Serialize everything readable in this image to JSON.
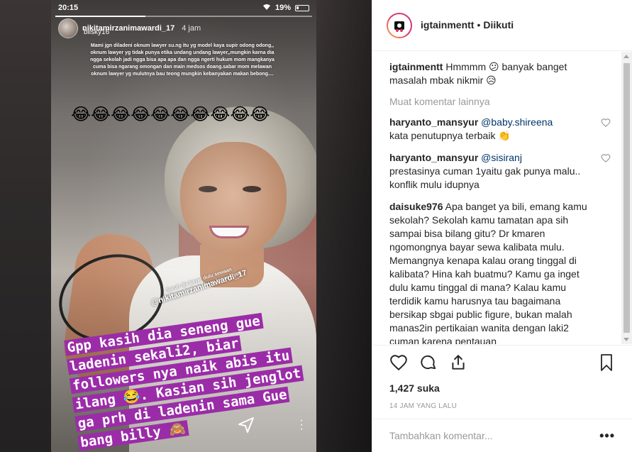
{
  "story": {
    "status_time": "20:15",
    "battery": "19%",
    "username": "nikitamirzanimawardi_17",
    "time": "4 jam",
    "tag": "bilsky16",
    "progress_fraction": 0.35,
    "top_text": "Mami jgn diladeni oknum lawyer su.ng itu yg model kaya supir odong odong,, oknum lawyer yg tidak punya etika undang undang lawyer,,mungkin karna dia ngga sekolah jadi ngga bisa apa apa dan ngga ngerti hukum mom mangkanya cuma bisa ngarang omongan dan main medsos doang.sabar mom melawan oknum lawyer yg mulutnya bau teong mungkin kebanyakan makan bebong....",
    "emoji_row": "😂😂😂😂😂😂😂😂😂😂",
    "small_overlay": "Suruh dia bayar dulu sewaan apartemen kalibata baru lawan nyali",
    "watermark": "@nikitamirzanimawardi_17",
    "caption_lines": [
      "Gpp kasih dia seneng gue",
      "ladenin sekali2, biar",
      "followers nya naik abis itu",
      "ilang 😂. Kasian sih jenglot",
      "ga prh di ladenin sama Gue",
      "bang billy 🙈"
    ]
  },
  "post": {
    "username": "igtainmentt",
    "dot": "•",
    "follow_label": "Diikuti",
    "caption": {
      "user": "igtainmentt",
      "text": "Hmmmm 😕 banyak banget masalah mbak nikmir 😥"
    },
    "load_more": "Muat komentar lainnya",
    "comments": [
      {
        "user": "haryanto_mansyur",
        "mention": "@baby.shireena",
        "text": "kata penutupnya terbaik 👏"
      },
      {
        "user": "haryanto_mansyur",
        "mention": "@sisiranj",
        "text": "prestasinya cuman 1yaitu gak punya malu.. konflik mulu idupnya"
      },
      {
        "user": "daisuke976",
        "mention": "",
        "text": "Apa banget ya bili, emang kamu sekolah? Sekolah kamu tamatan apa sih sampai bisa bilang gitu? Dr kmaren ngomongnya bayar sewa kalibata mulu. Memangnya kenapa kalau orang tinggal di kalibata? Hina kah buatmu? Kamu ga inget dulu kamu tinggal di mana? Kalau kamu terdidik kamu harusnya tau bagaimana bersikap sbgai public figure, bukan malah manas2in pertikaian wanita dengan laki2 cuman karena pentauan"
      }
    ],
    "likes": "1,427 suka",
    "time_ago": "14 JAM YANG LALU",
    "comment_placeholder": "Tambahkan komentar...",
    "more_label": "•••"
  },
  "colors": {
    "caption_highlight": "#9b2ca8",
    "mention": "#003569",
    "muted": "#999999",
    "text": "#262626"
  }
}
